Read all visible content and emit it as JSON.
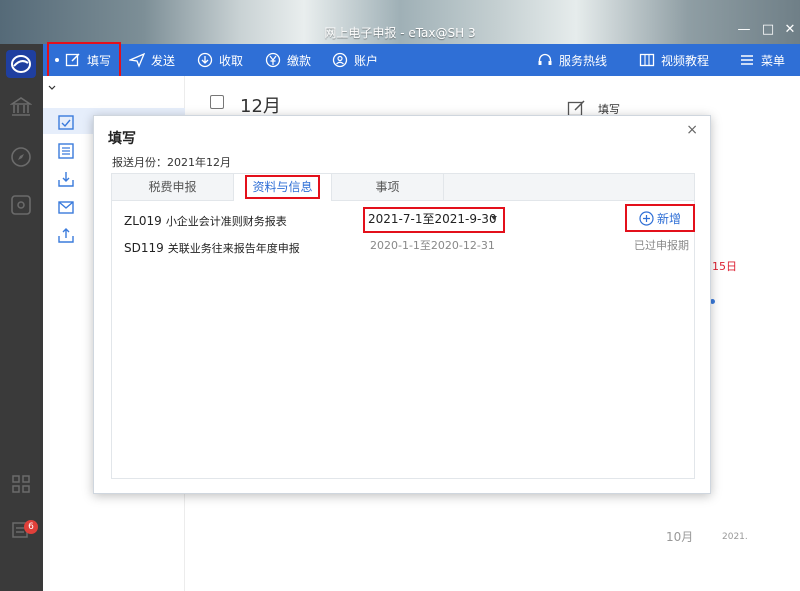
{
  "window": {
    "title": "网上电子申报 - eTax@SH 3",
    "minimize": "—",
    "maximize": "□",
    "close": "✕"
  },
  "toolbar": {
    "items": [
      {
        "label": "填写",
        "icon": "edit-icon"
      },
      {
        "label": "发送",
        "icon": "send-icon"
      },
      {
        "label": "收取",
        "icon": "download-icon"
      },
      {
        "label": "缴款",
        "icon": "yen-icon"
      },
      {
        "label": "账户",
        "icon": "user-icon"
      }
    ],
    "right_items": [
      {
        "label": "服务热线",
        "icon": "headset-icon"
      },
      {
        "label": "视频教程",
        "icon": "video-icon"
      },
      {
        "label": "菜单",
        "icon": "menu-icon"
      }
    ]
  },
  "appbar": {
    "badge_count": "6"
  },
  "background": {
    "month": "12月",
    "fill_label": "填写",
    "day_marker": "15日",
    "month_marker": "10月",
    "year_marker": "2021."
  },
  "modal": {
    "title": "填写",
    "close": "×",
    "report_month_label": "报送月份：2021年12月",
    "tabs": [
      "税费申报",
      "资料与信息",
      "事项"
    ],
    "active_tab": 1,
    "rows": [
      {
        "code": "ZL019",
        "name": "小企业会计准则财务报表",
        "period": "2021-7-1至2021-9-30",
        "action": "新增"
      },
      {
        "code": "SD119",
        "name": "关联业务往来报告年度申报",
        "period": "2020-1-1至2020-12-31",
        "status": "已过申报期"
      }
    ]
  },
  "colors": {
    "toolbar": "#2f6fd6",
    "highlight": "#e3101b",
    "appbar": "#3a3a3a"
  }
}
